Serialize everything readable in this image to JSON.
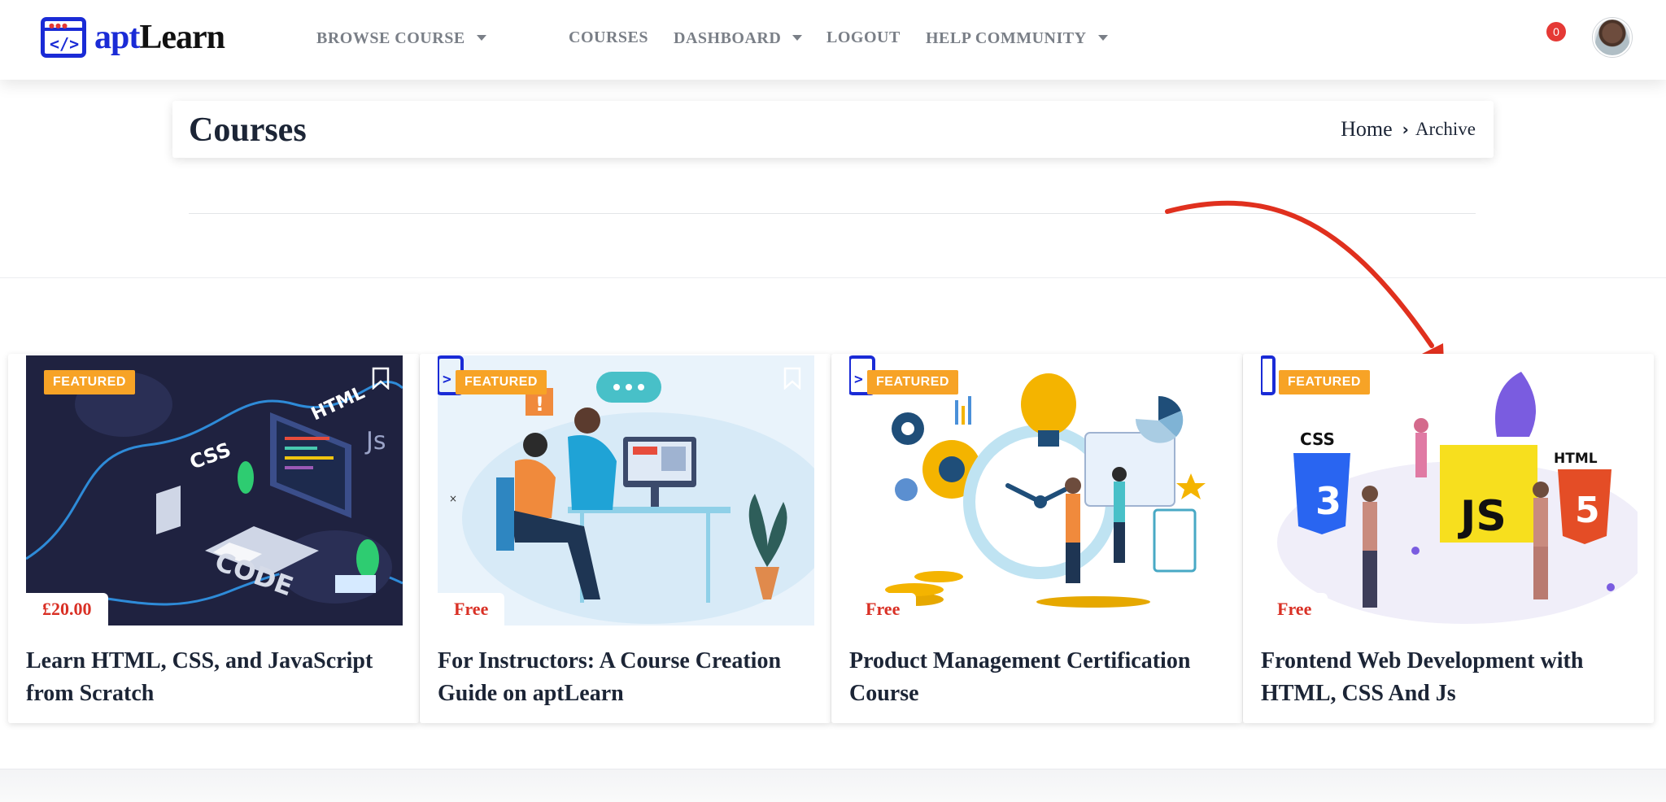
{
  "brand": {
    "name_a": "apt",
    "name_b": "Learn",
    "icon": "code-window-icon"
  },
  "nav": {
    "browse": "BROWSE COURSE",
    "courses": "COURSES",
    "dashboard": "DASHBOARD",
    "logout": "LOGOUT",
    "help": "HELP COMMUNITY"
  },
  "notifications": {
    "count": "0"
  },
  "page": {
    "title": "Courses"
  },
  "breadcrumb": {
    "home": "Home",
    "current": "Archive"
  },
  "courses": [
    {
      "badge": "FEATURED",
      "price": "£20.00",
      "title": "Learn HTML, CSS, and JavaScript from Scratch",
      "illustration": "coding-workstation-illustration"
    },
    {
      "badge": "FEATURED",
      "price": "Free",
      "title": "For Instructors: A Course Creation Guide on aptLearn",
      "illustration": "instructor-at-desk-illustration"
    },
    {
      "badge": "FEATURED",
      "price": "Free",
      "title": "Product Management Certification Course",
      "illustration": "time-management-illustration"
    },
    {
      "badge": "FEATURED",
      "price": "Free",
      "title": "Frontend Web Development with HTML, CSS And Js",
      "illustration": "html-css-js-illustration"
    }
  ],
  "colors": {
    "brand_blue": "#1a2bd6",
    "badge_orange": "#f7a326",
    "price_red": "#d93025",
    "annotation_red": "#e0301e"
  }
}
